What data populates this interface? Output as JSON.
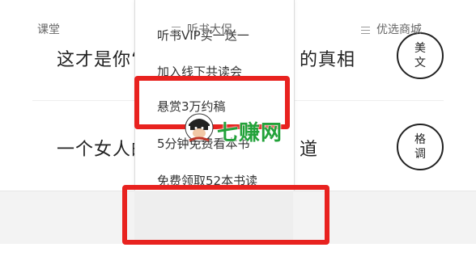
{
  "feed": {
    "item1": {
      "title_left": "这才是你‘",
      "title_right": "的真相",
      "badge_lines": [
        "美",
        "文"
      ]
    },
    "item2": {
      "title_left": "一个女人的",
      "title_right": "道",
      "badge_lines": [
        "格",
        "调"
      ]
    }
  },
  "menu": {
    "items": [
      "听书VIP买一送一",
      "加入线下共读会",
      "悬赏3万约稿",
      "5分钟免费看本书",
      "免费领取52本书读"
    ]
  },
  "tabbar": {
    "tabs": [
      "课堂",
      "听书大促",
      "优选商城"
    ]
  },
  "watermark": {
    "text": "七赚网"
  },
  "colors": {
    "highlight": "#e8221f",
    "watermark": "#22a23a",
    "tabbar_bg": "#f3f3f3"
  }
}
